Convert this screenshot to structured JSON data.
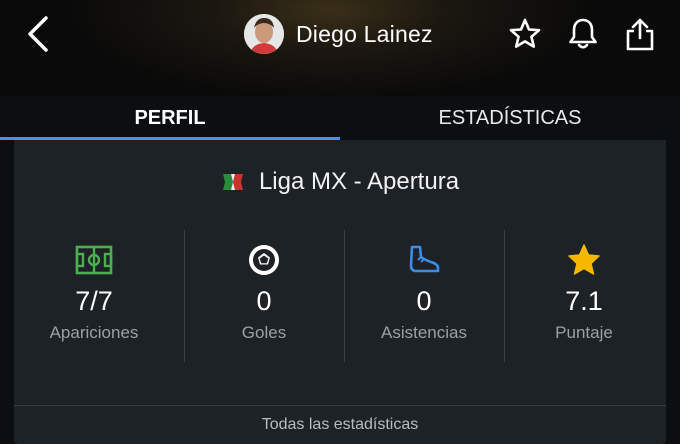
{
  "header": {
    "player_name": "Diego Lainez",
    "icons": {
      "back": "chevron-left-icon",
      "favorite": "star-outline-icon",
      "notifications": "bell-icon",
      "share": "share-icon"
    }
  },
  "tabs": [
    {
      "label": "PERFIL",
      "active": true
    },
    {
      "label": "ESTADÍSTICAS",
      "active": false
    }
  ],
  "league": {
    "name": "Liga MX - Apertura"
  },
  "stats": [
    {
      "value": "7/7",
      "label": "Apariciones",
      "icon": "pitch-icon",
      "color": "#4caf50"
    },
    {
      "value": "0",
      "label": "Goles",
      "icon": "soccer-ball-icon",
      "color": "#ffffff"
    },
    {
      "value": "0",
      "label": "Asistencias",
      "icon": "boot-icon",
      "color": "#3b8de8"
    },
    {
      "value": "7.1",
      "label": "Puntaje",
      "icon": "star-filled-icon",
      "color": "#f5b700"
    }
  ],
  "footer": {
    "link_label": "Todas las estadísticas"
  },
  "colors": {
    "accent": "#4a8ff0",
    "card_bg": "#1d2226",
    "page_bg": "#0c0f12"
  }
}
